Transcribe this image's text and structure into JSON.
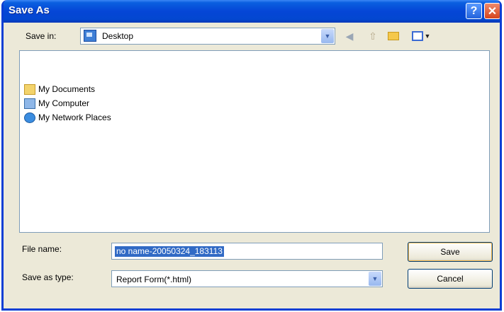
{
  "window": {
    "title": "Save As",
    "help_glyph": "?",
    "close_glyph": "✕"
  },
  "toolbar": {
    "save_in_label": "Save in:",
    "save_in_value": "Desktop",
    "icons": [
      "back-icon",
      "up-folder-icon",
      "new-folder-icon",
      "views-menu-icon"
    ]
  },
  "file_list": {
    "items": [
      {
        "label": "My Documents",
        "icon": "my-documents-icon"
      },
      {
        "label": "My Computer",
        "icon": "my-computer-icon"
      },
      {
        "label": "My Network Places",
        "icon": "my-network-places-icon"
      }
    ]
  },
  "form": {
    "file_name_label": "File name:",
    "file_name_value": "no name-20050324_183113",
    "save_as_type_label": "Save as type:",
    "save_as_type_value": "Report Form(*.html)"
  },
  "buttons": {
    "save": "Save",
    "cancel": "Cancel"
  }
}
